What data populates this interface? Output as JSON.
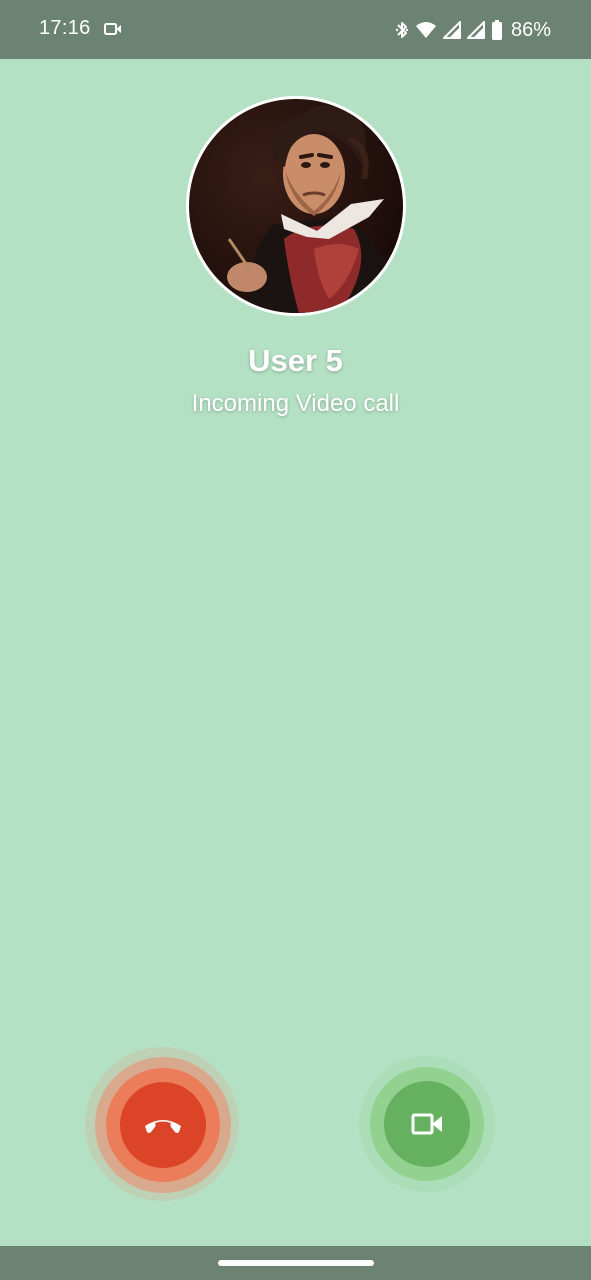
{
  "status_bar": {
    "time": "17:16",
    "notification_icon": "video-camera-icon",
    "icons": [
      "bluetooth-icon",
      "wifi-icon",
      "signal-icon",
      "signal-icon",
      "battery-icon"
    ],
    "battery_percent": "86%"
  },
  "caller": {
    "avatar": "portrait-avatar",
    "name": "User 5",
    "status": "Incoming Video call"
  },
  "actions": {
    "decline": {
      "icon": "hang-up-phone-icon",
      "color": "#dc4427"
    },
    "accept": {
      "icon": "video-camera-icon",
      "color": "#66b15f"
    }
  },
  "colors": {
    "background": "#b4e1c4",
    "system_bars": "#6c8272"
  }
}
